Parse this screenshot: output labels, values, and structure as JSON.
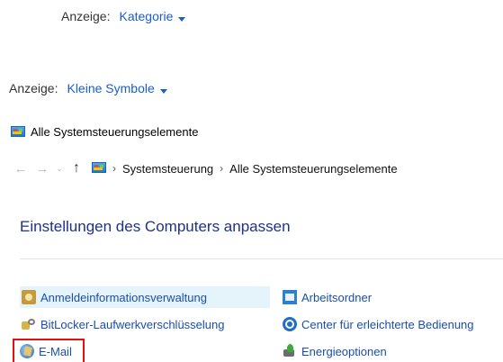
{
  "view_category": {
    "label": "Anzeige:",
    "value": "Kategorie"
  },
  "view_small": {
    "label": "Anzeige:",
    "value": "Kleine Symbole"
  },
  "window": {
    "title": "Alle Systemsteuerungselemente",
    "icon": "control-panel-icon"
  },
  "nav": {
    "back": "←",
    "forward": "→",
    "recent": "⌄",
    "up": "↑",
    "breadcrumbs": [
      "Systemsteuerung",
      "Alle Systemsteuerungselemente"
    ]
  },
  "heading": "Einstellungen des Computers anpassen",
  "items_left": [
    {
      "label": "Anmeldeinformationsverwaltung",
      "icon": "credential-manager-icon",
      "state": "hover"
    },
    {
      "label": "BitLocker-Laufwerkverschlüsselung",
      "icon": "bitlocker-icon",
      "state": "normal"
    },
    {
      "label": "E-Mail",
      "icon": "mail-icon",
      "state": "selected"
    }
  ],
  "items_right": [
    {
      "label": "Arbeitsordner",
      "icon": "work-folders-icon"
    },
    {
      "label": "Center für erleichterte Bedienung",
      "icon": "ease-of-access-icon"
    },
    {
      "label": "Energieoptionen",
      "icon": "power-options-icon"
    }
  ],
  "colors": {
    "link": "#1a5ec8",
    "heading": "#1e3287",
    "hover_bg": "#e5f3fb",
    "highlight_border": "#e21010"
  }
}
